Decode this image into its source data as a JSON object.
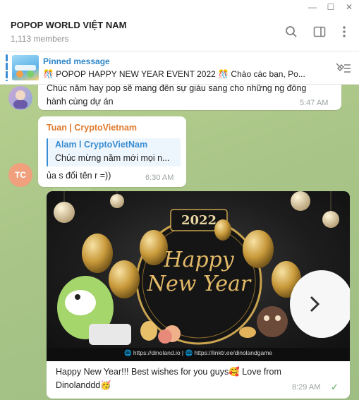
{
  "window": {
    "minimize_glyph": "—",
    "maximize_glyph": "☐",
    "close_glyph": "✕"
  },
  "header": {
    "title": "POPOP WORLD VIỆT NAM",
    "members": "1,113 members"
  },
  "pinned": {
    "label": "Pinned message",
    "text": "🎊 POPOP HAPPY NEW YEAR EVENT 2022 🎊  Chào các bạn, Po..."
  },
  "messages": [
    {
      "text_line1": "Chúc năm hay pop sẽ mang đến sự giàu sang cho những ng đồng",
      "text_line2": "hành cùng dự án",
      "time": "5:47 AM"
    },
    {
      "sender": "Tuan | CryptoVietnam",
      "avatar_initials": "TC",
      "reply_author": "Alam l CryptoVietNam",
      "reply_text": "Chúc mừng năm mới mọi n...",
      "text": "ủa s đổi tên r =))",
      "time": "6:30 AM"
    },
    {
      "image": {
        "year": "2022",
        "line1": "Happy",
        "line2": "New Year",
        "footer": "🌐 https://dinoland.io  |  🌐 https://linktr.ee/dinolandgame"
      },
      "text_line1": "Happy New Year!!! Best wishes for you guys🥰 Love from",
      "text_line2": "Dinolanddd🥳",
      "time": "8:29 AM",
      "status": "✓"
    }
  ],
  "colors": {
    "accent": "#3a8dd3",
    "sender": "#e07a2d",
    "chat_bg": "#a9c587"
  }
}
